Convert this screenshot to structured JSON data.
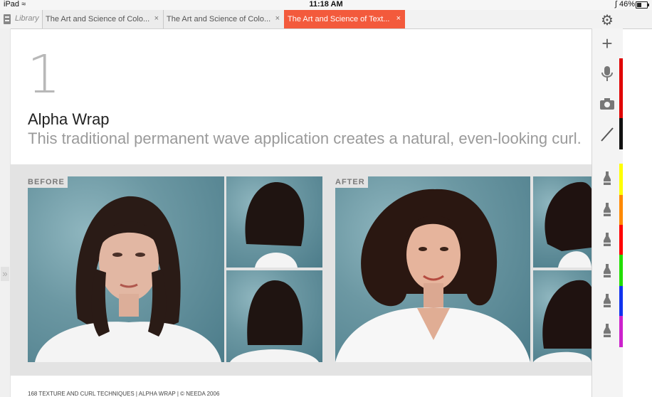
{
  "status_bar": {
    "device": "iPad",
    "time": "11:18 AM",
    "battery": "46%",
    "battery_level": 0.46
  },
  "tab_bar": {
    "library_label": "Library",
    "tabs": [
      {
        "label": "The Art and Science of Colo...",
        "close": "×"
      },
      {
        "label": "The Art and Science of Colo...",
        "close": "×"
      },
      {
        "label": "The Art and Science of Text...",
        "close": "×",
        "active": true
      }
    ]
  },
  "page": {
    "chapter_number": "1",
    "title": "Alpha Wrap",
    "subtitle": "This traditional permanent wave application creates a natural, even-looking curl.",
    "before_label": "BEFORE",
    "after_label": "AFTER",
    "footer": "168 TEXTURE AND CURL TECHNIQUES | ALPHA WRAP | © NEEDA 2006"
  },
  "toolbar": {
    "tools": [
      "plus-icon",
      "microphone-icon",
      "camera-icon",
      "pen-icon",
      "highlighter-icon",
      "highlighter-icon",
      "highlighter-icon",
      "highlighter-icon",
      "highlighter-icon",
      "highlighter-icon"
    ],
    "colors": [
      "#e00000",
      "#111111",
      "#ffff00",
      "#ff8a00",
      "#ff0000",
      "#22dd00",
      "#1133ee",
      "#cc22cc"
    ]
  }
}
